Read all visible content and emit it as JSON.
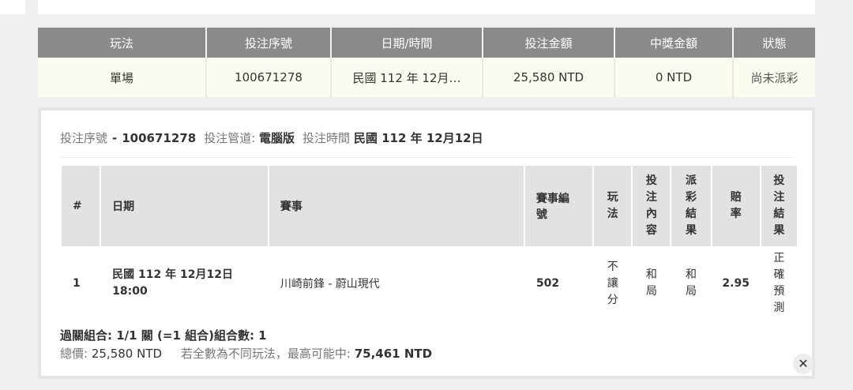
{
  "summary": {
    "headers": [
      "玩法",
      "投注序號",
      "日期/時間",
      "投注金額",
      "中獎金額",
      "狀態"
    ],
    "row": {
      "play": "單場",
      "serial": "100671278",
      "datetime": "民國 112 年 12月…",
      "amount": "25,580 NTD",
      "prize": "0 NTD",
      "status": "尚未派彩"
    }
  },
  "detail": {
    "serial_label": "投注序號",
    "serial_value": "100671278",
    "channel_label": "投注管道:",
    "channel_value": "電腦版",
    "time_label": "投注時間",
    "time_value": "民國 112 年 12月12日",
    "columns": {
      "index": "#",
      "date": "日期",
      "event": "賽事",
      "event_no_1": "賽事編",
      "event_no_2": "號",
      "play_1": "玩",
      "play_2": "法",
      "content": [
        "投",
        "注",
        "內",
        "容"
      ],
      "payout": [
        "派",
        "彩",
        "結",
        "果"
      ],
      "odds_1": "賠",
      "odds_2": "率",
      "result": [
        "投",
        "注",
        "結",
        "果"
      ]
    },
    "rows": [
      {
        "index": "1",
        "date_line1": "民國 112 年 12月12日",
        "date_line2": "18:00",
        "event": "川崎前鋒 - 蔚山現代",
        "event_no": "502",
        "play": [
          "不",
          "讓",
          "分"
        ],
        "content": [
          "和",
          "局"
        ],
        "payout": [
          "和",
          "局"
        ],
        "odds": "2.95",
        "result": [
          "正",
          "確",
          "預",
          "測"
        ]
      }
    ],
    "combo": "過關組合: 1/1 關 (=1 組合)組合數: 1",
    "total_label": "總價:",
    "total_value": "25,580 NTD",
    "max_label": "若全數為不同玩法，最高可能中:",
    "max_value": "75,461 NTD"
  },
  "close_icon": "✕"
}
